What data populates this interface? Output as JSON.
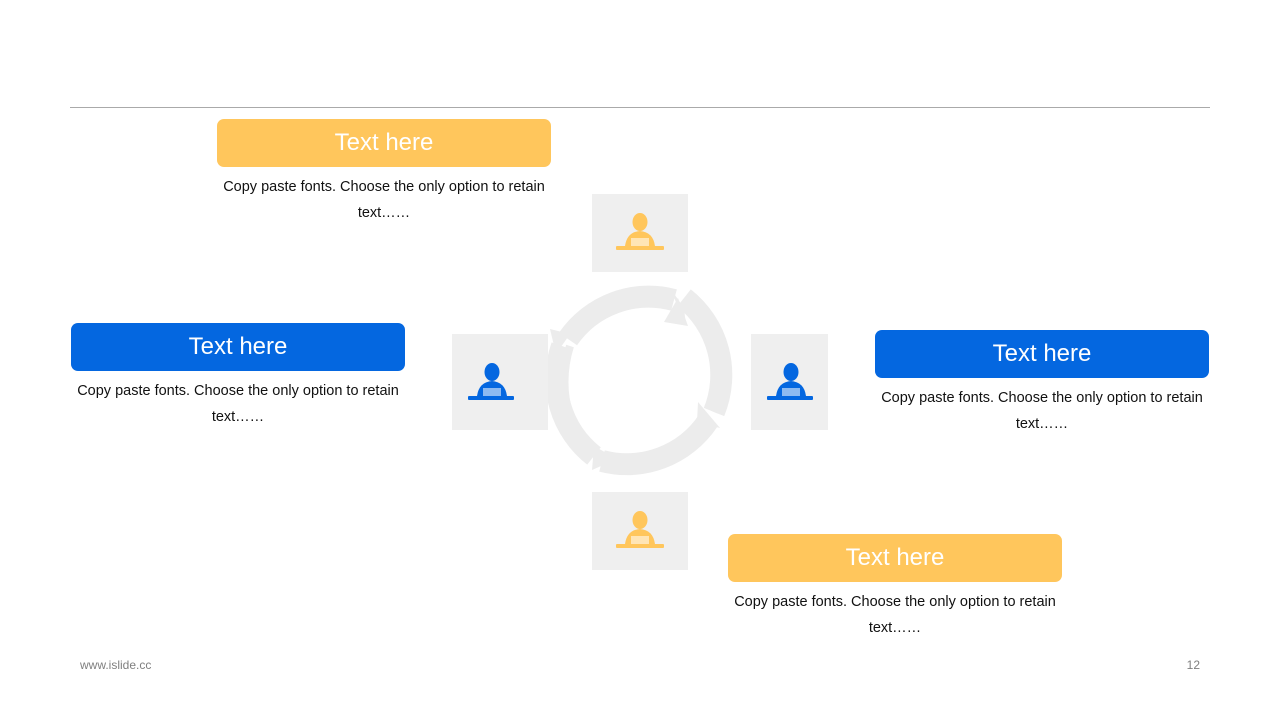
{
  "colors": {
    "accent_yellow": "#ffc65c",
    "accent_blue": "#0467e0",
    "tile_gray": "#efefef",
    "arrow_gray": "#ececec"
  },
  "blocks": [
    {
      "title": "Text here",
      "description": "Copy paste fonts. Choose the only option to retain text……"
    },
    {
      "title": "Text here",
      "description": "Copy paste fonts. Choose the only option to retain text……"
    },
    {
      "title": "Text here",
      "description": "Copy paste fonts. Choose the only option to retain text……"
    },
    {
      "title": "Text here",
      "description": "Copy paste fonts. Choose the only option to retain text……"
    }
  ],
  "icons": {
    "top": "person-at-laptop-icon",
    "left": "person-at-laptop-icon",
    "right": "person-at-laptop-icon",
    "bottom": "person-at-laptop-icon",
    "center": "cycle-arrows-icon"
  },
  "footer": {
    "url": "www.islide.cc",
    "page_number": "12"
  }
}
